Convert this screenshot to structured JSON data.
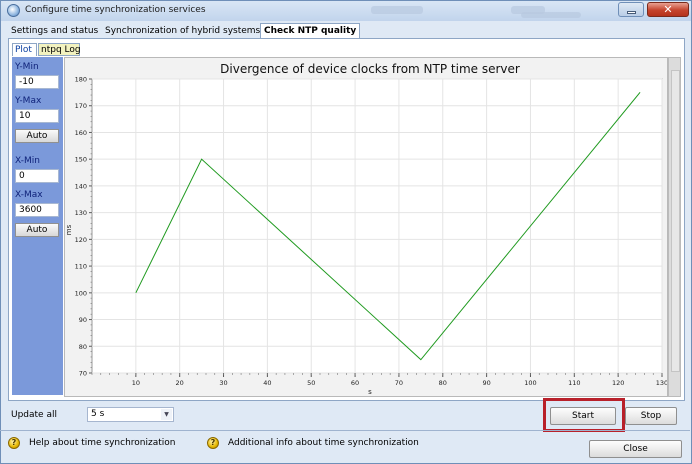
{
  "window": {
    "title": "Configure time synchronization services",
    "close_glyph": "✕"
  },
  "tabs": [
    "Settings and status",
    "Synchronization of hybrid systems",
    "Check NTP quality"
  ],
  "subtabs": [
    "Plot",
    "ntpq Log"
  ],
  "axis_panel": {
    "ymin_label": "Y-Min",
    "ymin_value": "-10",
    "ymax_label": "Y-Max",
    "ymax_value": "10",
    "auto_y": "Auto",
    "xmin_label": "X-Min",
    "xmin_value": "0",
    "xmax_label": "X-Max",
    "xmax_value": "3600",
    "auto_x": "Auto"
  },
  "chart_data": {
    "type": "line",
    "title": "Divergence of device clocks from NTP time server",
    "xlabel": "s",
    "ylabel": "ms",
    "xlim": [
      0,
      130
    ],
    "ylim": [
      70,
      180
    ],
    "xticks": [
      10,
      20,
      30,
      40,
      50,
      60,
      70,
      80,
      90,
      100,
      110,
      120,
      130
    ],
    "yticks": [
      70,
      80,
      90,
      100,
      110,
      120,
      130,
      140,
      150,
      160,
      170,
      180
    ],
    "grid": true,
    "series": [
      {
        "color": "#1f9a1f",
        "x": [
          10,
          25,
          75,
          125
        ],
        "y": [
          100,
          150,
          75,
          175
        ]
      }
    ]
  },
  "bottom": {
    "update_label": "Update all",
    "update_value": "5 s",
    "dropdown_glyph": "▼",
    "start_label": "Start",
    "stop_label": "Stop"
  },
  "footer": {
    "help_text": "Help about time synchronization",
    "info_text": "Additional info about time synchronization",
    "close_label": "Close",
    "help_glyph": "?"
  },
  "colors": {
    "accent_panel": "#7b99da",
    "series_line": "#1f9a1f",
    "highlight_frame": "#b8202a"
  },
  "icons": [
    "app-clock-icon",
    "minimize-icon",
    "close-icon",
    "question-icon",
    "dropdown-arrow-icon"
  ]
}
